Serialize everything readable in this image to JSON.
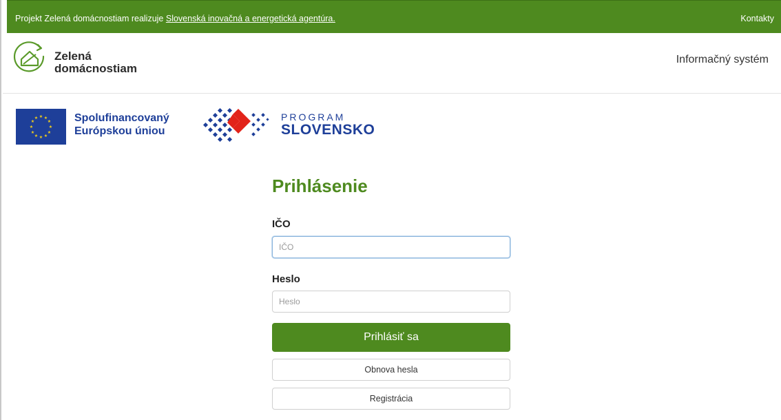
{
  "topbar": {
    "prefix": "Projekt Zelená domácnostiam realizuje ",
    "agency_link": "Slovenská inovačná a energetická agentúra.",
    "contacts": "Kontakty",
    "background": "#4e8a1f"
  },
  "header": {
    "logo_line1": "Zelená",
    "logo_line2": "domácnostiam",
    "logo_icon": "house-leaf-icon",
    "nav_right": "Informačný systém"
  },
  "partners": {
    "eu_line1": "Spolufinancovaný",
    "eu_line2": "Európskou úniou",
    "eu_flag_icon": "eu-flag-icon",
    "program_small": "PROGRAM",
    "program_big": "SLOVENSKO",
    "program_icon": "program-slovensko-logo",
    "brand_blue": "#1e3f99",
    "brand_red": "#e2231a"
  },
  "login": {
    "title": "Prihlásenie",
    "ico_label": "IČO",
    "ico_placeholder": "IČO",
    "ico_value": "",
    "password_label": "Heslo",
    "password_placeholder": "Heslo",
    "password_value": "",
    "submit_label": "Prihlásiť sa",
    "reset_label": "Obnova hesla",
    "register_label": "Registrácia"
  },
  "colors": {
    "accent_green": "#4e8a1f"
  }
}
